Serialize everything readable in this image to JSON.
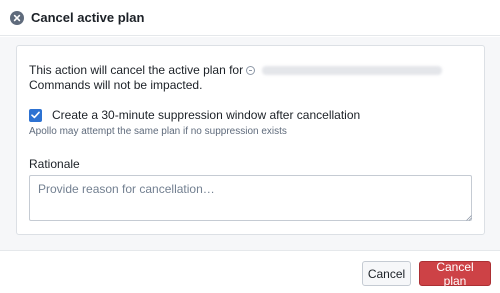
{
  "dialog": {
    "title": "Cancel active plan"
  },
  "card": {
    "action_text_prefix": "This action will cancel the active plan for",
    "action_text_suffix": "Commands will not be impacted.",
    "checkbox_label": "Create a 30-minute suppression window after cancellation",
    "checkbox_checked": true,
    "helper_text": "Apollo may attempt the same plan if no suppression exists",
    "rationale_label": "Rationale",
    "rationale_placeholder": "Provide reason for cancellation…",
    "rationale_value": ""
  },
  "footer": {
    "cancel_label": "Cancel",
    "cancel_plan_label": "Cancel plan"
  },
  "colors": {
    "accent": "#2d72d2",
    "danger": "#cd4246",
    "body_background": "#f6f7f9"
  },
  "icons": {
    "close": "close-circle-icon",
    "plan": "plan-icon",
    "check": "check-icon"
  }
}
